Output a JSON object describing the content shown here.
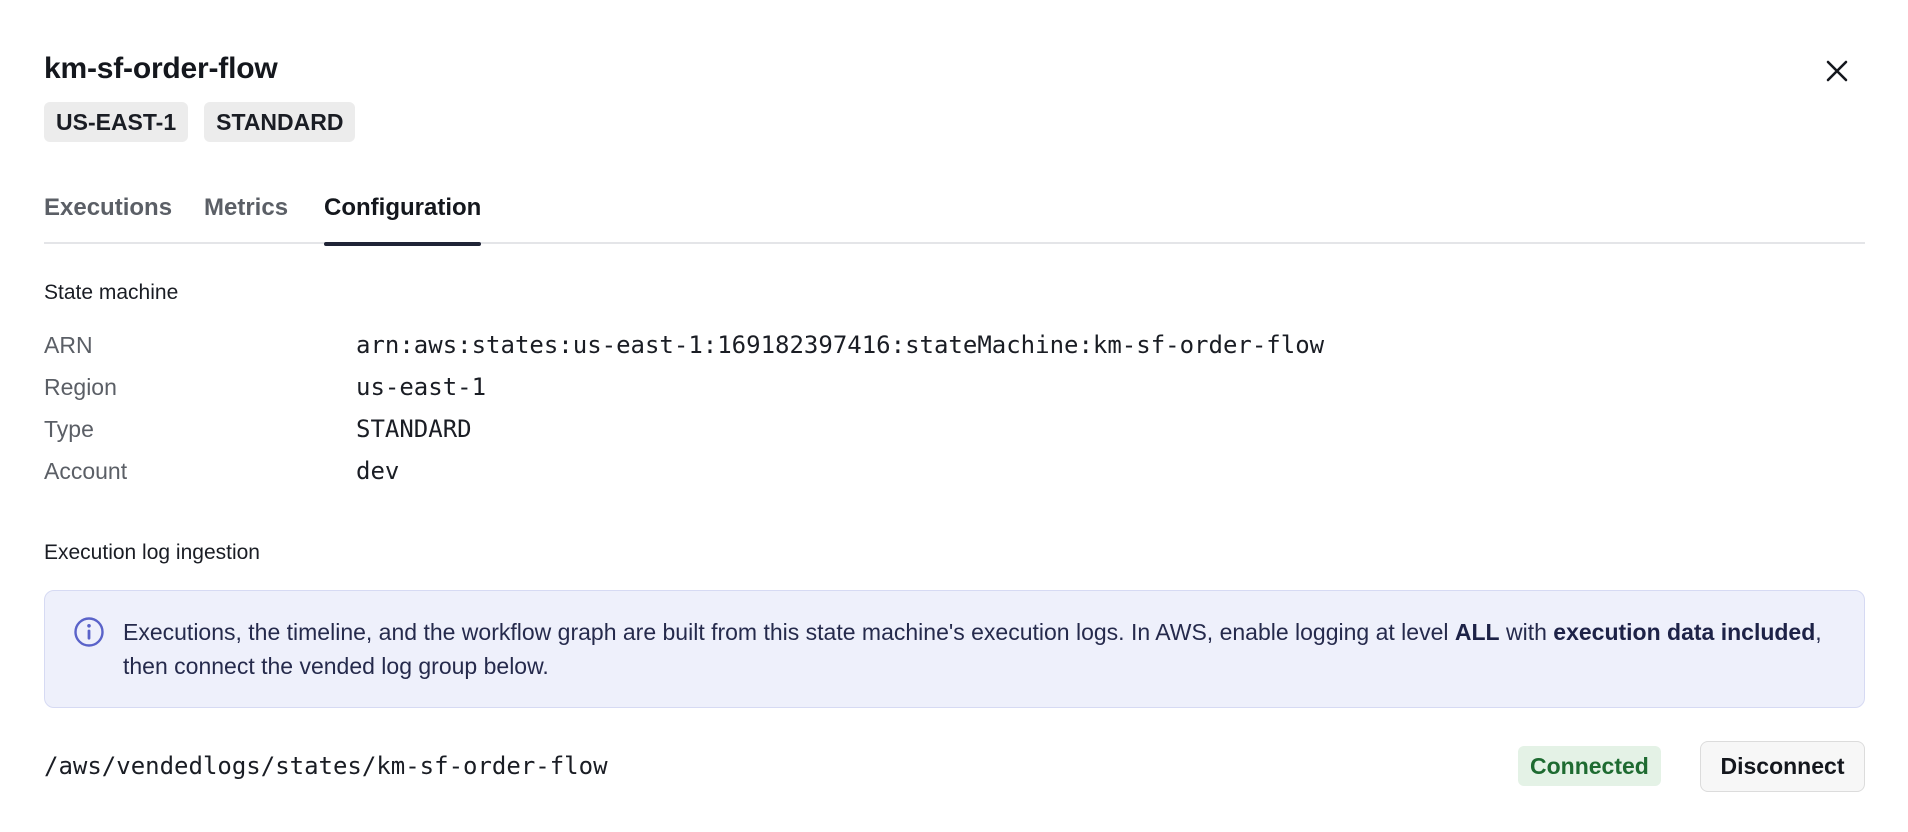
{
  "header": {
    "title": "km-sf-order-flow",
    "close_icon": "close-icon",
    "badges": [
      "US-EAST-1",
      "STANDARD"
    ]
  },
  "tabs": [
    {
      "label": "Executions",
      "active": false
    },
    {
      "label": "Metrics",
      "active": false
    },
    {
      "label": "Configuration",
      "active": true
    }
  ],
  "state_machine": {
    "section_title": "State machine",
    "rows": [
      {
        "key": "ARN",
        "value": "arn:aws:states:us-east-1:169182397416:stateMachine:km-sf-order-flow"
      },
      {
        "key": "Region",
        "value": "us-east-1"
      },
      {
        "key": "Type",
        "value": "STANDARD"
      },
      {
        "key": "Account",
        "value": "dev"
      }
    ]
  },
  "log_ingestion": {
    "section_title": "Execution log ingestion",
    "info_icon": "info-icon",
    "info_text_1": "Executions, the timeline, and the workflow graph are built from this state machine's execution logs. In AWS, enable logging at level ",
    "info_bold_1": "ALL",
    "info_text_2": " with ",
    "info_bold_2": "execution data included",
    "info_text_3": ", then connect the vended log group below.",
    "log_group": "/aws/vendedlogs/states/km-sf-order-flow",
    "status": "Connected",
    "status_color": "#1e6b31",
    "disconnect_label": "Disconnect"
  },
  "colors": {
    "accent": "#1f2436",
    "info_bg": "#eef0fb",
    "info_icon": "#5a63c9"
  }
}
